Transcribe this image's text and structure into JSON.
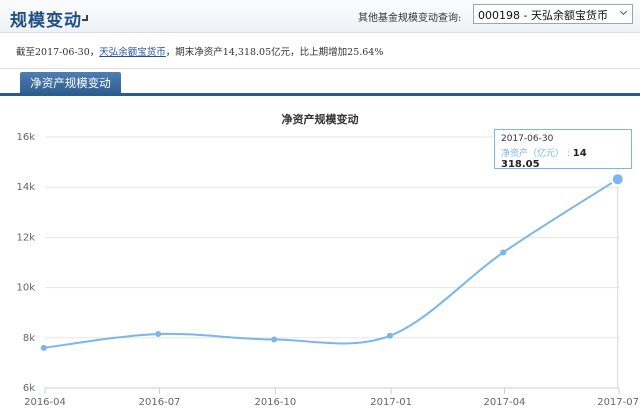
{
  "header": {
    "title": "规模变动",
    "query_label": "其他基金规模变动查询:",
    "fund_select_value": "000198 - 天弘余额宝货币"
  },
  "summary": {
    "prefix": "截至2017-06-30，",
    "fund_link": "天弘余额宝货币",
    "suffix": "，期末净资产14,318.05亿元，比上期增加25.64%"
  },
  "tabs": [
    {
      "label": "净资产规模变动",
      "active": true
    }
  ],
  "colors": {
    "accent": "#2c5a8b",
    "series": "#7cb5ec",
    "title": "#1f4f86"
  },
  "tooltip": {
    "date": "2017-06-30",
    "series_label": "净资产（亿元）",
    "value": "14 318.05"
  },
  "chart_data": {
    "type": "line",
    "title": "净资产规模变动",
    "x": [
      "2016-03-31",
      "2016-06-30",
      "2016-09-30",
      "2016-12-31",
      "2017-03-31",
      "2017-06-30"
    ],
    "x_tick_labels": [
      "2016-04",
      "2016-07",
      "2016-10",
      "2017-01",
      "2017-04",
      "2017-07"
    ],
    "y_tick_labels": [
      "6k",
      "8k",
      "10k",
      "12k",
      "14k",
      "16k"
    ],
    "ylim": [
      6000,
      16000
    ],
    "grid": true,
    "series": [
      {
        "name": "净资产（亿元）",
        "values": [
          7600,
          8150,
          7930,
          8080,
          11400,
          14318.05
        ]
      }
    ]
  }
}
